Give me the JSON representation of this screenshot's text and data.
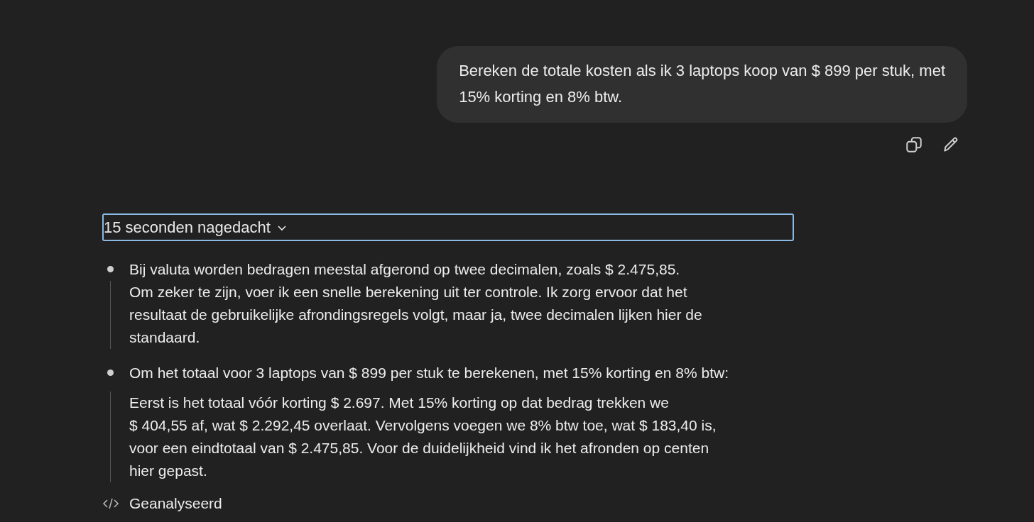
{
  "user_message": {
    "lines": [
      "Bereken de totale kosten als ik 3 laptops koop van $ 899 per stuk, met",
      "15% korting en 8% btw."
    ]
  },
  "thinking": {
    "label": "15 seconden nagedacht",
    "expanded": true,
    "steps": [
      {
        "heading": "Bij valuta worden bedragen meestal afgerond op twee decimalen, zoals $ 2.475,85.",
        "lines": [
          "Om zeker te zijn, voer ik een snelle berekening uit ter controle. Ik zorg ervoor dat het",
          "resultaat de gebruikelijke afrondingsregels volgt, maar ja, twee decimalen lijken hier de",
          "standaard."
        ]
      },
      {
        "heading": "Om het totaal voor 3 laptops van $ 899 per stuk te berekenen, met 15% korting en 8% btw:",
        "lines": [
          "Eerst is het totaal vóór korting $ 2.697. Met 15% korting op dat bedrag trekken we",
          "$ 404,55 af, wat $ 2.292,45 overlaat. Vervolgens voegen we 8% btw toe, wat $ 183,40 is,",
          "voor een eindtotaal van $ 2.475,85. Voor de duidelijkheid vind ik het afronden op centen",
          "hier gepast."
        ]
      }
    ]
  },
  "analysis": {
    "label": "Geanalyseerd"
  }
}
